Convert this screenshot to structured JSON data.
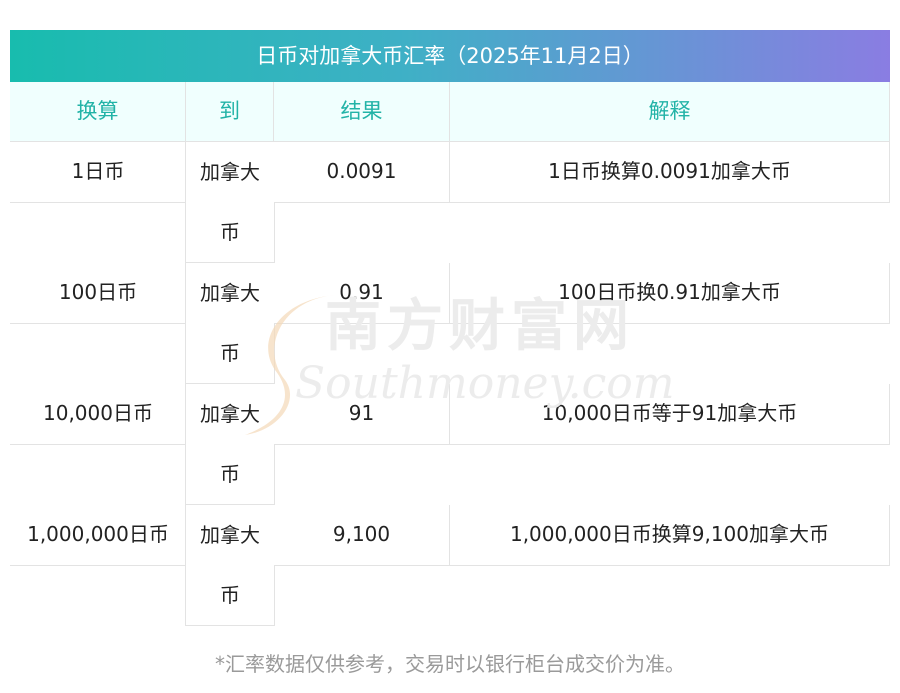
{
  "title": "日币对加拿大币汇率（2025年11月2日）",
  "headers": {
    "convert": "换算",
    "to": "到",
    "result": "结果",
    "explain": "解释"
  },
  "rows": [
    {
      "amount": "1日币",
      "to": "加拿大币",
      "result": "0.0091",
      "explain": "1日币换算0.0091加拿大币"
    },
    {
      "amount": "100日币",
      "to": "加拿大币",
      "result": "0.91",
      "explain": "100日币换0.91加拿大币"
    },
    {
      "amount": "10,000日币",
      "to": "加拿大币",
      "result": "91",
      "explain": "10,000日币等于91加拿大币"
    },
    {
      "amount": "1,000,000日币",
      "to": "加拿大币",
      "result": "9,100",
      "explain": "1,000,000日币换算9,100加拿大币"
    }
  ],
  "watermark": {
    "cn": "南方财富网",
    "en": "Southmoney.com"
  },
  "footnote": "*汇率数据仅供参考，交易时以银行柜台成交价为准。",
  "colors": {
    "header_text": "#22b3a7",
    "title_gradient_start": "#18bcae",
    "title_gradient_end": "#8a7de2",
    "header_bg": "#f0fffe"
  }
}
